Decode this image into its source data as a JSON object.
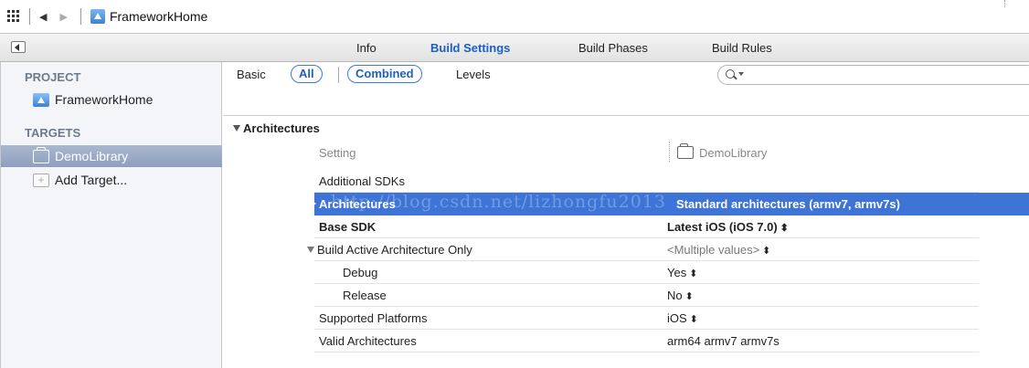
{
  "pathbar": {
    "title": "FrameworkHome"
  },
  "tabs": [
    {
      "label": "Info",
      "active": false
    },
    {
      "label": "Build Settings",
      "active": true
    },
    {
      "label": "Build Phases",
      "active": false
    },
    {
      "label": "Build Rules",
      "active": false
    }
  ],
  "sidebar": {
    "project_header": "PROJECT",
    "project_item": "FrameworkHome",
    "targets_header": "TARGETS",
    "target_item": "DemoLibrary",
    "add_target": "Add Target..."
  },
  "filter": {
    "basic": "Basic",
    "all": "All",
    "combined": "Combined",
    "levels": "Levels",
    "search_placeholder": ""
  },
  "settings": {
    "section": "Architectures",
    "col_setting": "Setting",
    "col_target": "DemoLibrary",
    "rows": [
      {
        "name": "Additional SDKs",
        "value": ""
      },
      {
        "name": "Architectures",
        "value": "Standard architectures (armv7, armv7s)"
      },
      {
        "name": "Base SDK",
        "value": "Latest iOS (iOS 7.0)"
      },
      {
        "name": "Build Active Architecture Only",
        "value": "<Multiple values>"
      },
      {
        "name": "Debug",
        "value": "Yes"
      },
      {
        "name": "Release",
        "value": "No"
      },
      {
        "name": "Supported Platforms",
        "value": "iOS"
      },
      {
        "name": "Valid Architectures",
        "value": "arm64 armv7 armv7s"
      }
    ]
  },
  "watermark": "http://blog.csdn.net/lizhongfu2013",
  "colors": {
    "accent": "#1a5fcc",
    "selection": "#3d74d6",
    "sidebar_selection": "#9aabc8"
  }
}
